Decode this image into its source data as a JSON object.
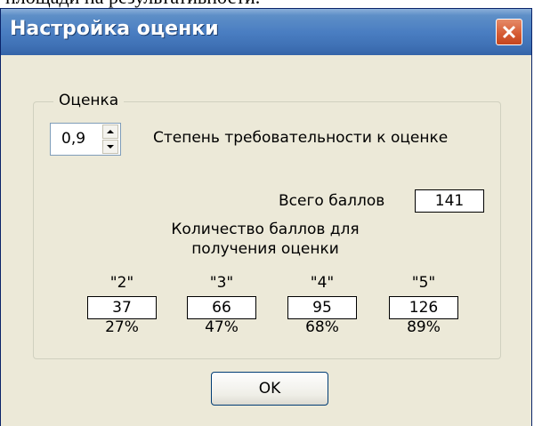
{
  "background_text": "площади на результативности.",
  "window": {
    "title": "Настройка оценки"
  },
  "group": {
    "label": "Оценка",
    "strictness": {
      "value": "0,9",
      "label": "Степень требовательности к оценке"
    },
    "total": {
      "label": "Всего баллов",
      "value": "141"
    },
    "grades_title": [
      "Количество баллов для",
      "получения оценки"
    ],
    "grades": [
      {
        "name": "\"2\"",
        "points": "37",
        "percent": "27%"
      },
      {
        "name": "\"3\"",
        "points": "66",
        "percent": "47%"
      },
      {
        "name": "\"4\"",
        "points": "95",
        "percent": "68%"
      },
      {
        "name": "\"5\"",
        "points": "126",
        "percent": "89%"
      }
    ]
  },
  "ok_button": "OK"
}
